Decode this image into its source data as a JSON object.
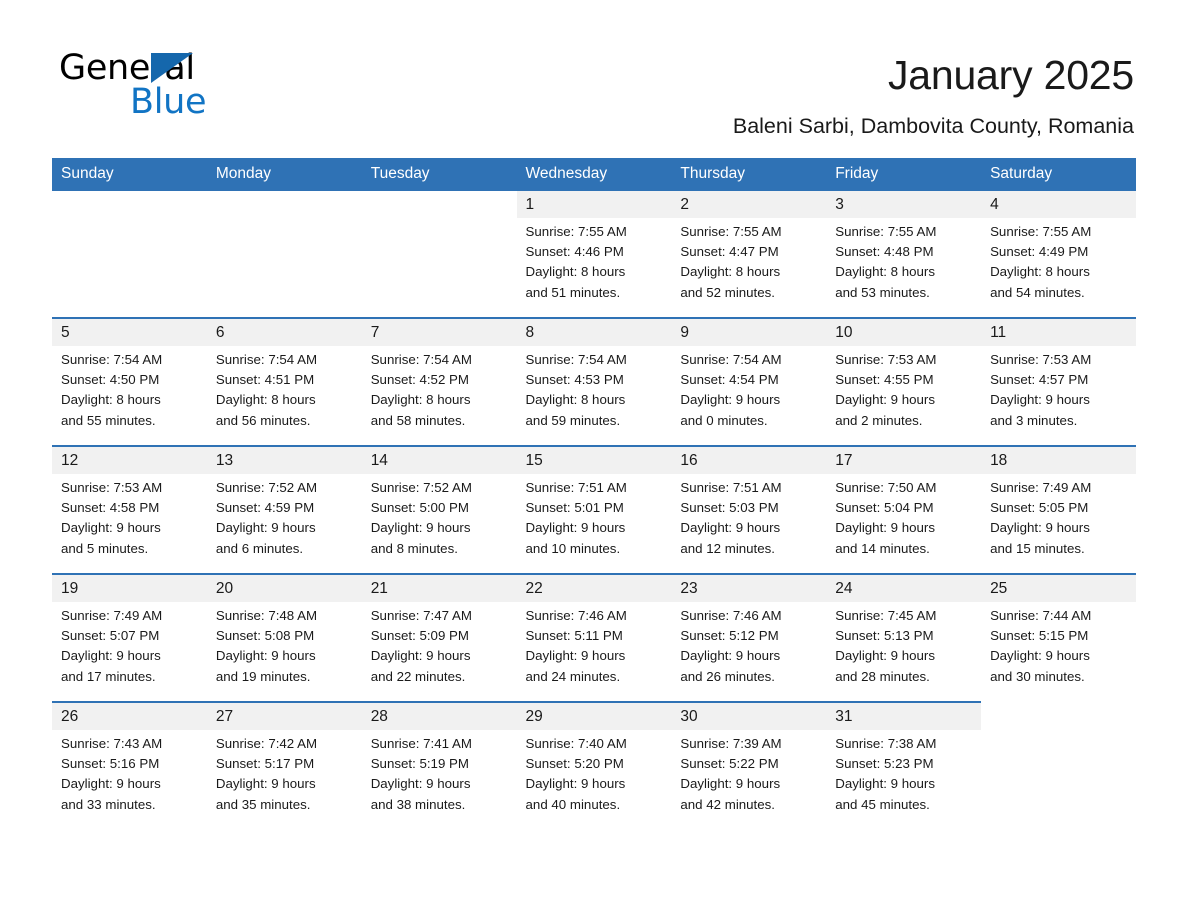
{
  "brand": {
    "name_part1": "General",
    "name_part2": "Blue",
    "triangle_color": "#1567ac",
    "blue_text_color": "#1174c4"
  },
  "header": {
    "title": "January 2025",
    "subtitle": "Baleni Sarbi, Dambovita County, Romania"
  },
  "theme": {
    "header_blue": "#2f72b5",
    "daynum_band": "#f1f1f1",
    "text": "#1a1a1a"
  },
  "calendar": {
    "weekday_headers": [
      "Sunday",
      "Monday",
      "Tuesday",
      "Wednesday",
      "Thursday",
      "Friday",
      "Saturday"
    ],
    "weeks": [
      [
        {
          "day": "",
          "lines": []
        },
        {
          "day": "",
          "lines": []
        },
        {
          "day": "",
          "lines": []
        },
        {
          "day": "1",
          "lines": [
            "Sunrise: 7:55 AM",
            "Sunset: 4:46 PM",
            "Daylight: 8 hours",
            "and 51 minutes."
          ]
        },
        {
          "day": "2",
          "lines": [
            "Sunrise: 7:55 AM",
            "Sunset: 4:47 PM",
            "Daylight: 8 hours",
            "and 52 minutes."
          ]
        },
        {
          "day": "3",
          "lines": [
            "Sunrise: 7:55 AM",
            "Sunset: 4:48 PM",
            "Daylight: 8 hours",
            "and 53 minutes."
          ]
        },
        {
          "day": "4",
          "lines": [
            "Sunrise: 7:55 AM",
            "Sunset: 4:49 PM",
            "Daylight: 8 hours",
            "and 54 minutes."
          ]
        }
      ],
      [
        {
          "day": "5",
          "lines": [
            "Sunrise: 7:54 AM",
            "Sunset: 4:50 PM",
            "Daylight: 8 hours",
            "and 55 minutes."
          ]
        },
        {
          "day": "6",
          "lines": [
            "Sunrise: 7:54 AM",
            "Sunset: 4:51 PM",
            "Daylight: 8 hours",
            "and 56 minutes."
          ]
        },
        {
          "day": "7",
          "lines": [
            "Sunrise: 7:54 AM",
            "Sunset: 4:52 PM",
            "Daylight: 8 hours",
            "and 58 minutes."
          ]
        },
        {
          "day": "8",
          "lines": [
            "Sunrise: 7:54 AM",
            "Sunset: 4:53 PM",
            "Daylight: 8 hours",
            "and 59 minutes."
          ]
        },
        {
          "day": "9",
          "lines": [
            "Sunrise: 7:54 AM",
            "Sunset: 4:54 PM",
            "Daylight: 9 hours",
            "and 0 minutes."
          ]
        },
        {
          "day": "10",
          "lines": [
            "Sunrise: 7:53 AM",
            "Sunset: 4:55 PM",
            "Daylight: 9 hours",
            "and 2 minutes."
          ]
        },
        {
          "day": "11",
          "lines": [
            "Sunrise: 7:53 AM",
            "Sunset: 4:57 PM",
            "Daylight: 9 hours",
            "and 3 minutes."
          ]
        }
      ],
      [
        {
          "day": "12",
          "lines": [
            "Sunrise: 7:53 AM",
            "Sunset: 4:58 PM",
            "Daylight: 9 hours",
            "and 5 minutes."
          ]
        },
        {
          "day": "13",
          "lines": [
            "Sunrise: 7:52 AM",
            "Sunset: 4:59 PM",
            "Daylight: 9 hours",
            "and 6 minutes."
          ]
        },
        {
          "day": "14",
          "lines": [
            "Sunrise: 7:52 AM",
            "Sunset: 5:00 PM",
            "Daylight: 9 hours",
            "and 8 minutes."
          ]
        },
        {
          "day": "15",
          "lines": [
            "Sunrise: 7:51 AM",
            "Sunset: 5:01 PM",
            "Daylight: 9 hours",
            "and 10 minutes."
          ]
        },
        {
          "day": "16",
          "lines": [
            "Sunrise: 7:51 AM",
            "Sunset: 5:03 PM",
            "Daylight: 9 hours",
            "and 12 minutes."
          ]
        },
        {
          "day": "17",
          "lines": [
            "Sunrise: 7:50 AM",
            "Sunset: 5:04 PM",
            "Daylight: 9 hours",
            "and 14 minutes."
          ]
        },
        {
          "day": "18",
          "lines": [
            "Sunrise: 7:49 AM",
            "Sunset: 5:05 PM",
            "Daylight: 9 hours",
            "and 15 minutes."
          ]
        }
      ],
      [
        {
          "day": "19",
          "lines": [
            "Sunrise: 7:49 AM",
            "Sunset: 5:07 PM",
            "Daylight: 9 hours",
            "and 17 minutes."
          ]
        },
        {
          "day": "20",
          "lines": [
            "Sunrise: 7:48 AM",
            "Sunset: 5:08 PM",
            "Daylight: 9 hours",
            "and 19 minutes."
          ]
        },
        {
          "day": "21",
          "lines": [
            "Sunrise: 7:47 AM",
            "Sunset: 5:09 PM",
            "Daylight: 9 hours",
            "and 22 minutes."
          ]
        },
        {
          "day": "22",
          "lines": [
            "Sunrise: 7:46 AM",
            "Sunset: 5:11 PM",
            "Daylight: 9 hours",
            "and 24 minutes."
          ]
        },
        {
          "day": "23",
          "lines": [
            "Sunrise: 7:46 AM",
            "Sunset: 5:12 PM",
            "Daylight: 9 hours",
            "and 26 minutes."
          ]
        },
        {
          "day": "24",
          "lines": [
            "Sunrise: 7:45 AM",
            "Sunset: 5:13 PM",
            "Daylight: 9 hours",
            "and 28 minutes."
          ]
        },
        {
          "day": "25",
          "lines": [
            "Sunrise: 7:44 AM",
            "Sunset: 5:15 PM",
            "Daylight: 9 hours",
            "and 30 minutes."
          ]
        }
      ],
      [
        {
          "day": "26",
          "lines": [
            "Sunrise: 7:43 AM",
            "Sunset: 5:16 PM",
            "Daylight: 9 hours",
            "and 33 minutes."
          ]
        },
        {
          "day": "27",
          "lines": [
            "Sunrise: 7:42 AM",
            "Sunset: 5:17 PM",
            "Daylight: 9 hours",
            "and 35 minutes."
          ]
        },
        {
          "day": "28",
          "lines": [
            "Sunrise: 7:41 AM",
            "Sunset: 5:19 PM",
            "Daylight: 9 hours",
            "and 38 minutes."
          ]
        },
        {
          "day": "29",
          "lines": [
            "Sunrise: 7:40 AM",
            "Sunset: 5:20 PM",
            "Daylight: 9 hours",
            "and 40 minutes."
          ]
        },
        {
          "day": "30",
          "lines": [
            "Sunrise: 7:39 AM",
            "Sunset: 5:22 PM",
            "Daylight: 9 hours",
            "and 42 minutes."
          ]
        },
        {
          "day": "31",
          "lines": [
            "Sunrise: 7:38 AM",
            "Sunset: 5:23 PM",
            "Daylight: 9 hours",
            "and 45 minutes."
          ]
        },
        {
          "day": "",
          "lines": []
        }
      ]
    ]
  }
}
